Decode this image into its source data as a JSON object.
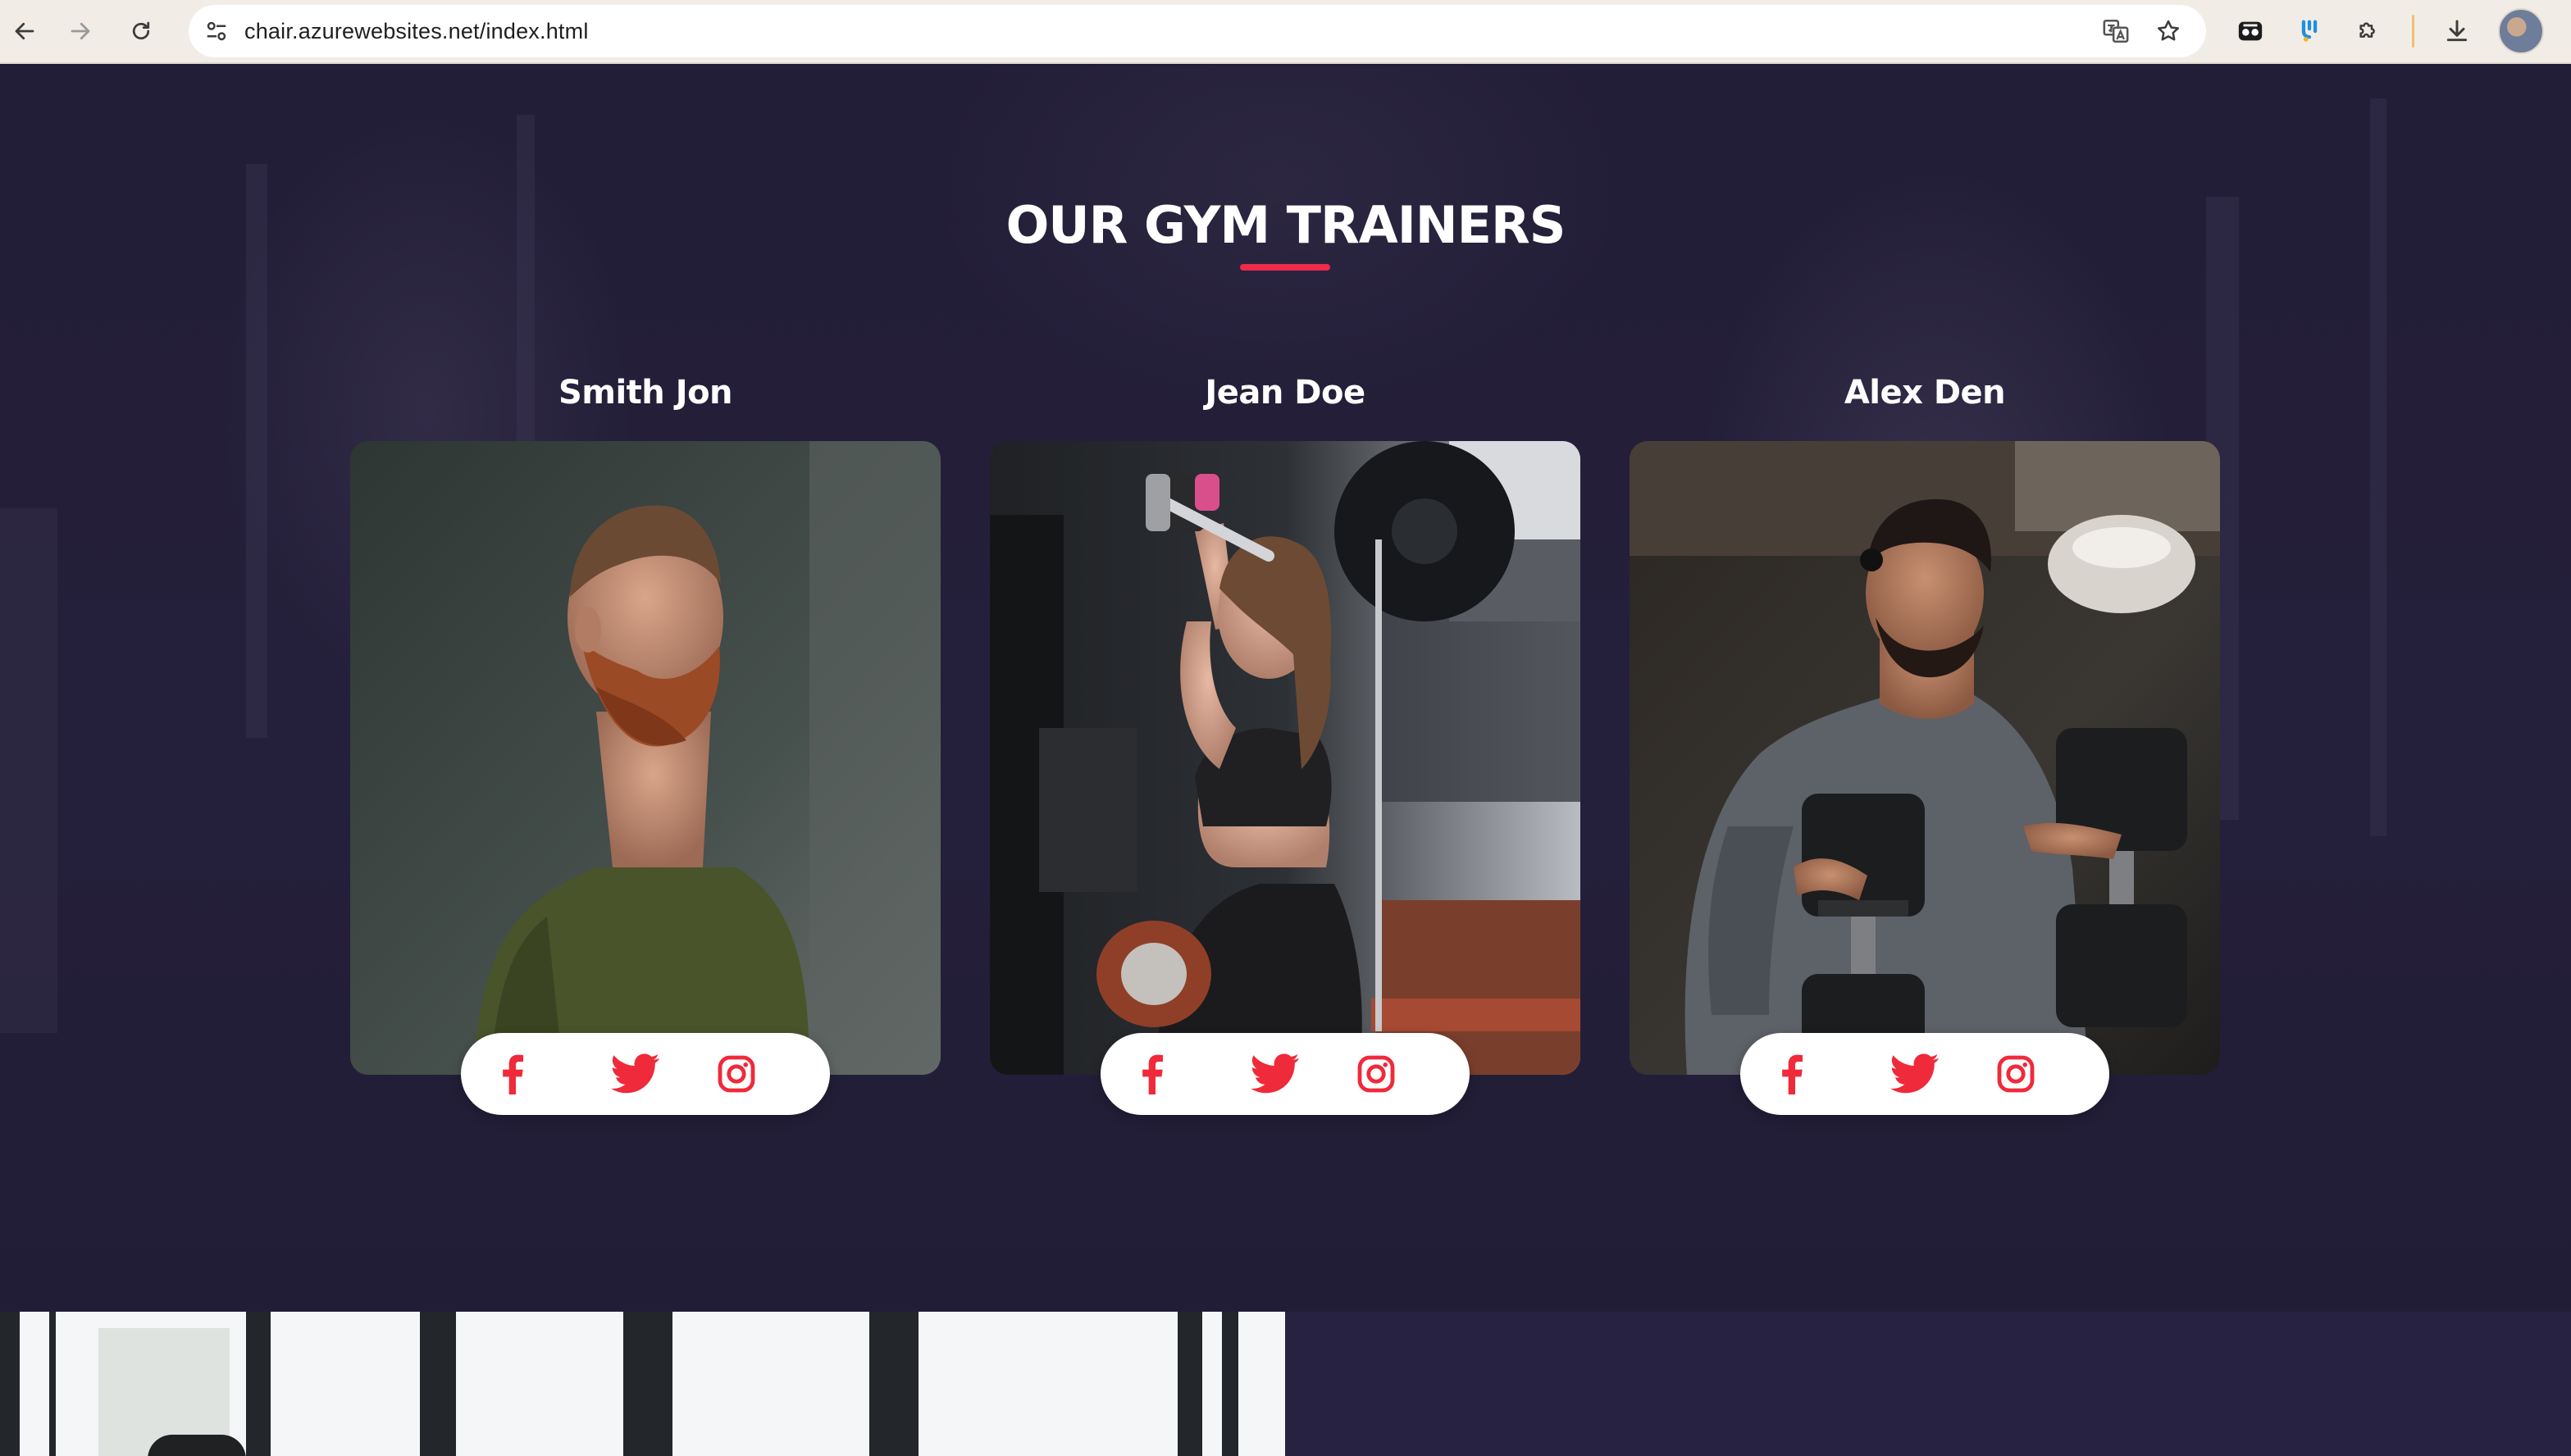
{
  "browser": {
    "url": "chair.azurewebsites.net/index.html"
  },
  "section": {
    "title": "OUR GYM TRAINERS",
    "accent_color": "#ef2a4a",
    "background_color": "#231e38"
  },
  "trainers": [
    {
      "name": "Smith Jon",
      "social": [
        "facebook-icon",
        "twitter-icon",
        "instagram-icon"
      ]
    },
    {
      "name": "Jean Doe",
      "social": [
        "facebook-icon",
        "twitter-icon",
        "instagram-icon"
      ]
    },
    {
      "name": "Alex Den",
      "social": [
        "facebook-icon",
        "twitter-icon",
        "instagram-icon"
      ]
    }
  ]
}
